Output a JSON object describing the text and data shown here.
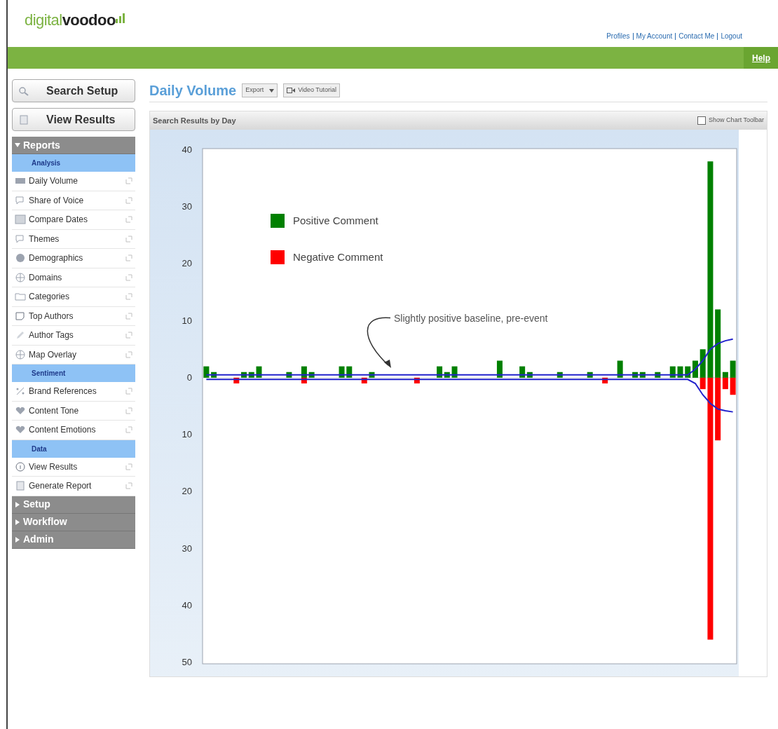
{
  "header": {
    "logo": {
      "first": "digital",
      "second": "voodoo"
    },
    "links": [
      "Profiles",
      "My Account",
      "Contact Me",
      "Logout"
    ],
    "help": "Help"
  },
  "sidebar": {
    "buttons": [
      {
        "label": "Search Setup",
        "kind": "search"
      },
      {
        "label": "View Results",
        "kind": "page"
      }
    ],
    "sections": [
      {
        "title": "Reports",
        "expanded": true,
        "groups": [
          {
            "title": "Analysis",
            "items": [
              {
                "label": "Daily Volume",
                "kind": "bars"
              },
              {
                "label": "Share of Voice",
                "kind": "bubble"
              },
              {
                "label": "Compare Dates",
                "kind": "calendar"
              },
              {
                "label": "Themes",
                "kind": "bubble"
              },
              {
                "label": "Demographics",
                "kind": "pie"
              },
              {
                "label": "Domains",
                "kind": "globe"
              },
              {
                "label": "Categories",
                "kind": "folder"
              },
              {
                "label": "Top Authors",
                "kind": "note"
              },
              {
                "label": "Author Tags",
                "kind": "pencil"
              },
              {
                "label": "Map Overlay",
                "kind": "globe"
              }
            ]
          },
          {
            "title": "Sentiment",
            "items": [
              {
                "label": "Brand References",
                "kind": "percent"
              },
              {
                "label": "Content Tone",
                "kind": "heart"
              },
              {
                "label": "Content Emotions",
                "kind": "heart"
              }
            ]
          },
          {
            "title": "Data",
            "items": [
              {
                "label": "View Results",
                "kind": "info"
              },
              {
                "label": "Generate Report",
                "kind": "page"
              }
            ]
          }
        ]
      },
      {
        "title": "Setup",
        "expanded": false
      },
      {
        "title": "Workflow",
        "expanded": false
      },
      {
        "title": "Admin",
        "expanded": false
      }
    ]
  },
  "main": {
    "title": "Daily Volume",
    "export": "Export",
    "tutorial": "Video Tutorial",
    "panel": {
      "title": "Search Results by Day",
      "toolbar_toggle": {
        "label": "Show Chart Toolbar",
        "checked": false
      },
      "chart_data": {
        "type": "bar",
        "stacked": true,
        "legend": true,
        "ylim": [
          -50,
          40
        ],
        "yticks": [
          {
            "value": 40,
            "label": "40"
          },
          {
            "value": 30,
            "label": "30"
          },
          {
            "value": 20,
            "label": "20"
          },
          {
            "value": 10,
            "label": "10"
          },
          {
            "value": 0,
            "label": "0"
          },
          {
            "value": -10,
            "label": "10"
          },
          {
            "value": -20,
            "label": "20"
          },
          {
            "value": -30,
            "label": "30"
          },
          {
            "value": -40,
            "label": "40"
          },
          {
            "value": -50,
            "label": "50"
          }
        ],
        "series": [
          {
            "name": "Positive Comment",
            "color": "#008000",
            "values": [
              2,
              1,
              0,
              0,
              0,
              1,
              1,
              2,
              0,
              0,
              0,
              1,
              0,
              2,
              1,
              0,
              0,
              0,
              2,
              2,
              0,
              0,
              1,
              0,
              0,
              0,
              0,
              0,
              0,
              0,
              0,
              2,
              1,
              2,
              0,
              0,
              0,
              0,
              0,
              3,
              0,
              0,
              2,
              1,
              0,
              0,
              0,
              1,
              0,
              0,
              0,
              1,
              0,
              0,
              0,
              3,
              0,
              1,
              1,
              0,
              1,
              0,
              2,
              2,
              2,
              3,
              5,
              38,
              12,
              1,
              3
            ]
          },
          {
            "name": "Negative Comment",
            "color": "#ff0000",
            "values": [
              0,
              0,
              0,
              0,
              -1,
              0,
              0,
              0,
              0,
              0,
              0,
              0,
              0,
              -1,
              0,
              0,
              0,
              0,
              0,
              0,
              0,
              -1,
              0,
              0,
              0,
              0,
              0,
              0,
              -1,
              0,
              0,
              0,
              0,
              0,
              0,
              0,
              0,
              0,
              0,
              0,
              0,
              0,
              0,
              0,
              0,
              0,
              0,
              0,
              0,
              0,
              0,
              0,
              0,
              -1,
              0,
              0,
              0,
              0,
              0,
              0,
              0,
              0,
              0,
              0,
              0,
              0,
              -2,
              -46,
              -11,
              -2,
              -3
            ]
          },
          {
            "type": "line",
            "color": "#2222cc",
            "values": [
              0.5,
              0.5,
              0.5,
              0.5,
              0.5,
              0.5,
              0.5,
              0.5,
              0.5,
              0.5,
              0.5,
              0.5,
              0.5,
              0.5,
              0.5,
              0.5,
              0.5,
              0.5,
              0.5,
              0.5,
              0.5,
              0.5,
              0.5,
              0.5,
              0.5,
              0.5,
              0.5,
              0.5,
              0.5,
              0.5,
              0.5,
              0.5,
              0.5,
              0.5,
              0.5,
              0.5,
              0.5,
              0.5,
              0.5,
              0.5,
              0.5,
              0.5,
              0.5,
              0.5,
              0.5,
              0.5,
              0.5,
              0.5,
              0.5,
              0.5,
              0.5,
              0.5,
              0.5,
              0.5,
              0.5,
              0.5,
              0.5,
              0.5,
              0.5,
              0.5,
              0.5,
              0.5,
              0.5,
              0.5,
              0.5,
              1.5,
              3,
              5,
              6,
              6.5,
              6.8
            ]
          },
          {
            "type": "line",
            "color": "#2222cc",
            "values": [
              -0.3,
              -0.3,
              -0.3,
              -0.3,
              -0.3,
              -0.3,
              -0.3,
              -0.3,
              -0.3,
              -0.3,
              -0.3,
              -0.3,
              -0.3,
              -0.3,
              -0.3,
              -0.3,
              -0.3,
              -0.3,
              -0.3,
              -0.3,
              -0.3,
              -0.3,
              -0.3,
              -0.3,
              -0.3,
              -0.3,
              -0.3,
              -0.3,
              -0.3,
              -0.3,
              -0.3,
              -0.3,
              -0.3,
              -0.3,
              -0.3,
              -0.3,
              -0.3,
              -0.3,
              -0.3,
              -0.3,
              -0.3,
              -0.3,
              -0.3,
              -0.3,
              -0.3,
              -0.3,
              -0.3,
              -0.3,
              -0.3,
              -0.3,
              -0.3,
              -0.3,
              -0.3,
              -0.3,
              -0.3,
              -0.3,
              -0.3,
              -0.3,
              -0.3,
              -0.3,
              -0.3,
              -0.3,
              -0.3,
              -0.3,
              -0.3,
              -1,
              -3,
              -4.5,
              -5.5,
              -5.8,
              -6
            ]
          }
        ],
        "annotations": [
          "Slightly positive baseline, pre-event"
        ]
      }
    }
  }
}
